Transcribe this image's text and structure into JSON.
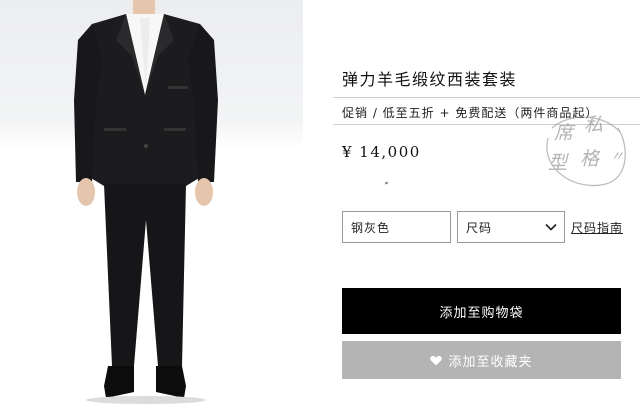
{
  "product": {
    "title": "弹力羊毛缎纹西装套装",
    "promo": "促销 / 低至五折 + 免费配送（两件商品起）",
    "price": "¥ 14,000",
    "image_icon": "suit-model-photo"
  },
  "watermark": {
    "chars": [
      "席",
      "私",
      "型",
      "格"
    ],
    "marks": "〃"
  },
  "options": {
    "color_value": "钢灰色",
    "size_value": "尺码",
    "size_guide_label": "尺码指南"
  },
  "actions": {
    "add_to_bag": "添加至购物袋",
    "add_to_wishlist": "添加至收藏夹"
  },
  "colors": {
    "primary_button": "#000000",
    "secondary_button": "#b4b4b4",
    "suit": "#1c1c1e"
  }
}
